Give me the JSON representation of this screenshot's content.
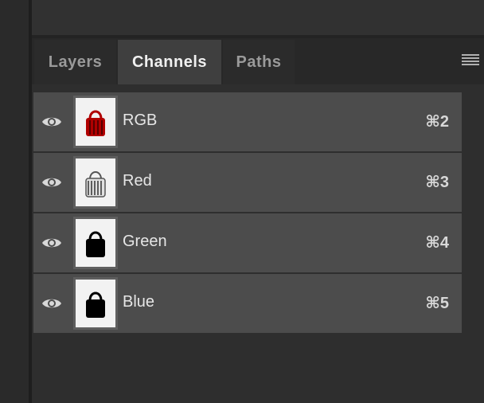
{
  "tabs": [
    {
      "label": "Layers",
      "active": false
    },
    {
      "label": "Channels",
      "active": true
    },
    {
      "label": "Paths",
      "active": false
    }
  ],
  "channels": [
    {
      "name": "RGB",
      "shortcut": "⌘2",
      "thumb_color": "#b00000",
      "visible": true
    },
    {
      "name": "Red",
      "shortcut": "⌘3",
      "thumb_color": "#555555",
      "visible": true
    },
    {
      "name": "Green",
      "shortcut": "⌘4",
      "thumb_color": "#000000",
      "visible": true
    },
    {
      "name": "Blue",
      "shortcut": "⌘5",
      "thumb_color": "#000000",
      "visible": true
    }
  ],
  "icons": {
    "visibility": "eye-icon",
    "panel_menu": "hamburger-menu-icon"
  },
  "colors": {
    "panel_bg": "#2e2e2e",
    "row_bg": "#4c4c4c",
    "active_tab_bg": "#3f3f3f"
  }
}
